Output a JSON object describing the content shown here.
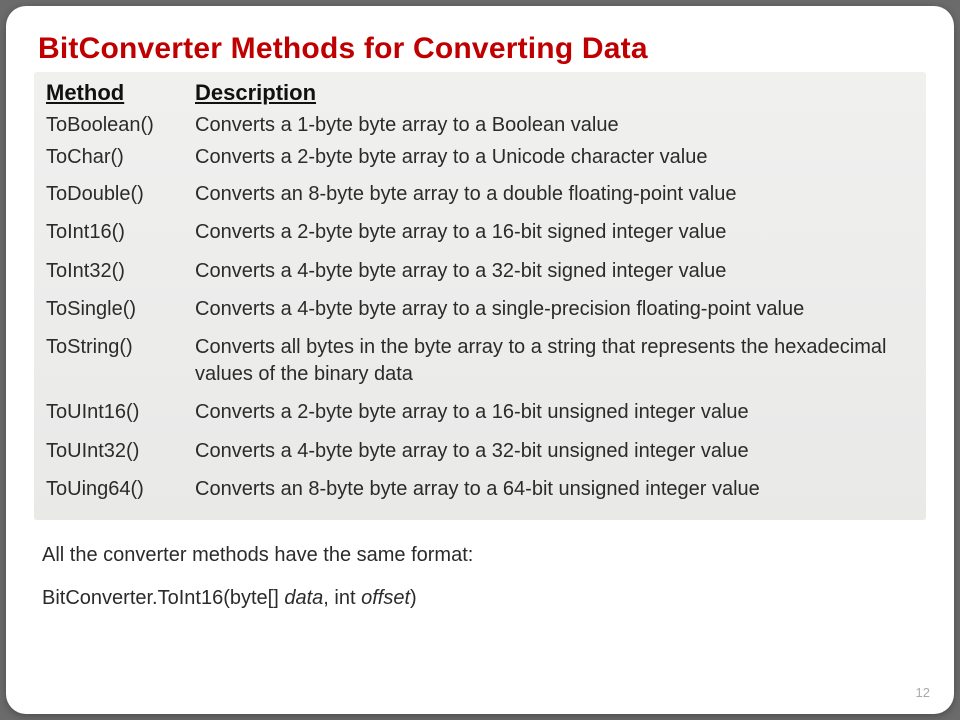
{
  "title": "BitConverter Methods for Converting Data",
  "headers": {
    "method": "Method",
    "description": "Description"
  },
  "rows": [
    {
      "method": "ToBoolean()",
      "desc": "Converts a 1-byte byte array to a Boolean value"
    },
    {
      "method": "ToChar()",
      "desc": "Converts a 2-byte byte array to a Unicode character value"
    },
    {
      "method": "ToDouble()",
      "desc": "Converts an 8-byte byte array to a double floating-point value"
    },
    {
      "method": "ToInt16()",
      "desc": "Converts a 2-byte byte array to a 16-bit signed integer value"
    },
    {
      "method": "ToInt32()",
      "desc": "Converts a 4-byte byte array to a 32-bit signed integer value"
    },
    {
      "method": "ToSingle()",
      "desc": "Converts a 4-byte byte array to a single-precision floating-point value"
    },
    {
      "method": "ToString()",
      "desc": "Converts all bytes in the byte array to a string that represents the hexadecimal values of the binary data"
    },
    {
      "method": "ToUInt16()",
      "desc": "Converts a 2-byte byte array to a 16-bit unsigned integer value"
    },
    {
      "method": "ToUInt32()",
      "desc": "Converts a 4-byte byte array to a 32-bit unsigned integer value"
    },
    {
      "method": "ToUing64()",
      "desc": "Converts an 8-byte byte array to a 64-bit unsigned integer value"
    }
  ],
  "note_line": "All the converter methods have the same format:",
  "code": {
    "prefix": "BitConverter.ToInt16(byte[] ",
    "param1": "data",
    "mid": ", int ",
    "param2": "offset",
    "suffix": ")"
  },
  "page_number": "12"
}
